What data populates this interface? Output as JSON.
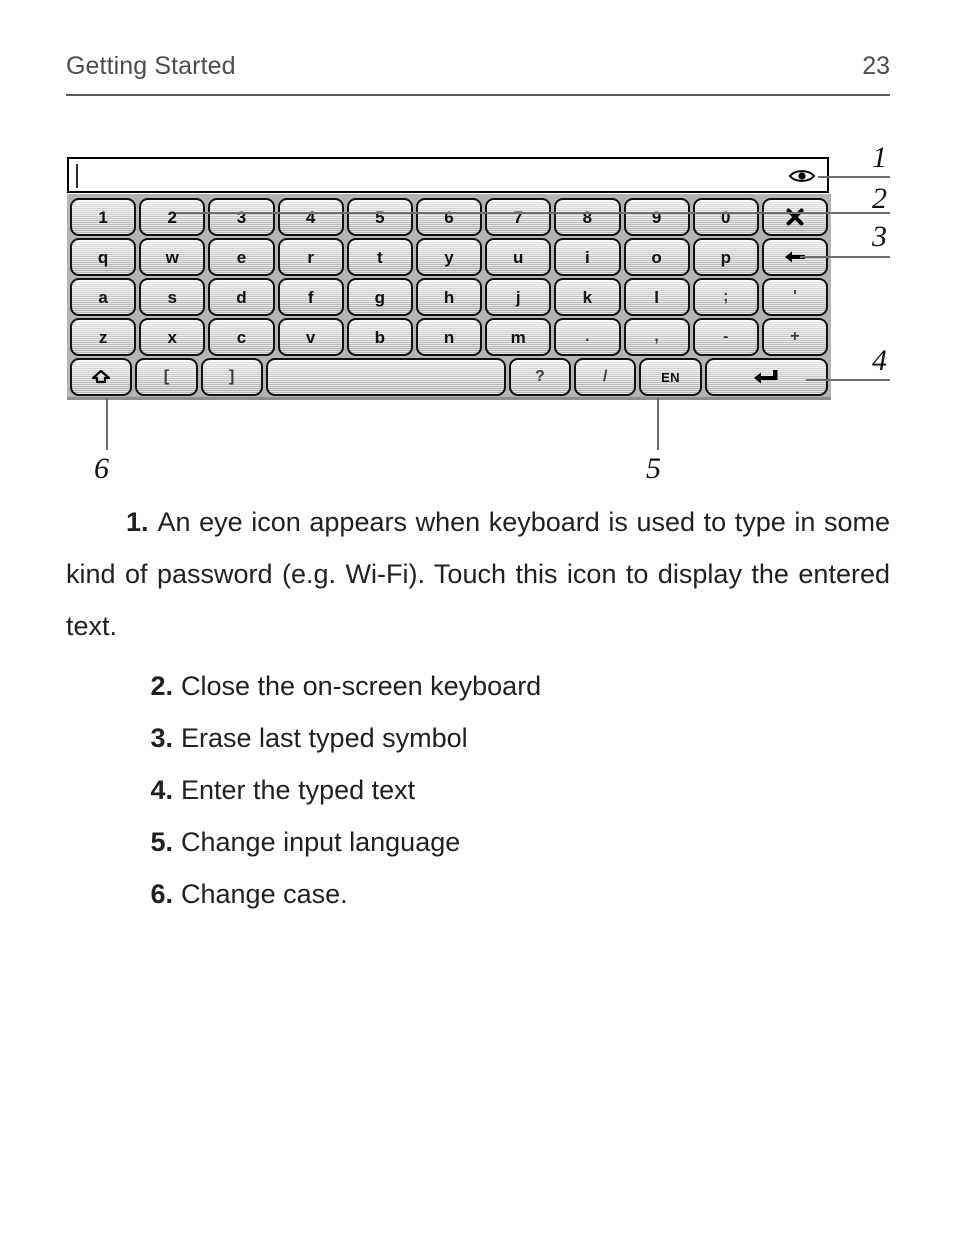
{
  "header": {
    "title": "Getting Started",
    "page_number": "23"
  },
  "figure": {
    "input_field": {
      "value": "",
      "caret_visible": true,
      "eye_icon": "eye-icon"
    },
    "keyboard": {
      "rows": [
        {
          "name": "number-row",
          "keys": [
            {
              "label": "1",
              "type": "char"
            },
            {
              "label": "2",
              "type": "char"
            },
            {
              "label": "3",
              "type": "char"
            },
            {
              "label": "4",
              "type": "char"
            },
            {
              "label": "5",
              "type": "char"
            },
            {
              "label": "6",
              "type": "char"
            },
            {
              "label": "7",
              "type": "char"
            },
            {
              "label": "8",
              "type": "char"
            },
            {
              "label": "9",
              "type": "char"
            },
            {
              "label": "0",
              "type": "char"
            },
            {
              "label": "",
              "type": "icon",
              "icon": "close-icon"
            }
          ]
        },
        {
          "name": "top-letter-row",
          "keys": [
            {
              "label": "q",
              "type": "char"
            },
            {
              "label": "w",
              "type": "char"
            },
            {
              "label": "e",
              "type": "char"
            },
            {
              "label": "r",
              "type": "char"
            },
            {
              "label": "t",
              "type": "char"
            },
            {
              "label": "y",
              "type": "char"
            },
            {
              "label": "u",
              "type": "char"
            },
            {
              "label": "i",
              "type": "char"
            },
            {
              "label": "o",
              "type": "char"
            },
            {
              "label": "p",
              "type": "char"
            },
            {
              "label": "",
              "type": "icon",
              "icon": "backspace-icon"
            }
          ]
        },
        {
          "name": "home-letter-row",
          "keys": [
            {
              "label": "a",
              "type": "char"
            },
            {
              "label": "s",
              "type": "char"
            },
            {
              "label": "d",
              "type": "char"
            },
            {
              "label": "f",
              "type": "char"
            },
            {
              "label": "g",
              "type": "char"
            },
            {
              "label": "h",
              "type": "char"
            },
            {
              "label": "j",
              "type": "char"
            },
            {
              "label": "k",
              "type": "char"
            },
            {
              "label": "l",
              "type": "char"
            },
            {
              "label": ";",
              "type": "punct"
            },
            {
              "label": "'",
              "type": "punct"
            }
          ]
        },
        {
          "name": "bottom-letter-row",
          "keys": [
            {
              "label": "z",
              "type": "char"
            },
            {
              "label": "x",
              "type": "char"
            },
            {
              "label": "c",
              "type": "char"
            },
            {
              "label": "v",
              "type": "char"
            },
            {
              "label": "b",
              "type": "char"
            },
            {
              "label": "n",
              "type": "char"
            },
            {
              "label": "m",
              "type": "char"
            },
            {
              "label": ".",
              "type": "punct"
            },
            {
              "label": ",",
              "type": "punct"
            },
            {
              "label": "-",
              "type": "punct"
            },
            {
              "label": "+",
              "type": "punct"
            }
          ]
        },
        {
          "name": "function-row",
          "keys": [
            {
              "label": "",
              "type": "icon",
              "icon": "shift-icon"
            },
            {
              "label": "[",
              "type": "punct"
            },
            {
              "label": "]",
              "type": "punct"
            },
            {
              "label": "",
              "type": "space"
            },
            {
              "label": "?",
              "type": "punct"
            },
            {
              "label": "/",
              "type": "punct"
            },
            {
              "label": "EN",
              "type": "lang"
            },
            {
              "label": "",
              "type": "icon",
              "icon": "enter-icon"
            }
          ]
        }
      ]
    },
    "callouts": [
      {
        "number": "1",
        "target": "eye-icon"
      },
      {
        "number": "2",
        "target": "close-key"
      },
      {
        "number": "3",
        "target": "backspace-key"
      },
      {
        "number": "4",
        "target": "enter-key"
      },
      {
        "number": "5",
        "target": "language-key"
      },
      {
        "number": "6",
        "target": "shift-key"
      }
    ]
  },
  "content": {
    "item1": {
      "marker": "1.",
      "text": "An eye icon appears when keyboard is used to type in some kind of password (e.g. Wi-Fi). Touch this icon to display the entered text."
    },
    "items": [
      {
        "marker": "2.",
        "text": "Close the on-screen keyboard"
      },
      {
        "marker": "3.",
        "text": "Erase last typed symbol"
      },
      {
        "marker": "4.",
        "text": "Enter the typed text"
      },
      {
        "marker": "5.",
        "text": "Change input language"
      },
      {
        "marker": "6.",
        "text": "Change case."
      }
    ]
  },
  "colors": {
    "text": "#231f20",
    "header_text": "#4d4d4f",
    "rule": "#58595b",
    "keyboard_bg": "#b4b4b4",
    "key_outline": "#111111",
    "leader_line": "#6d6e71"
  }
}
